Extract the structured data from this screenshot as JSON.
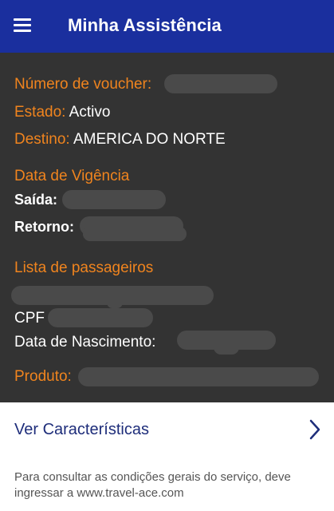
{
  "appbar": {
    "title": "Minha Assistência",
    "menu_icon": "hamburger-menu-icon"
  },
  "voucher": {
    "number_label": "Número de voucher:",
    "status_label": "Estado:",
    "status_value": "Activo",
    "destination_label": "Destino:",
    "destination_value": "AMERICA DO NORTE"
  },
  "validity": {
    "heading": "Data de Vigência",
    "departure_label": "Saída:",
    "return_label": "Retorno:"
  },
  "passengers": {
    "heading": "Lista de passageiros",
    "cpf_label": "CPF",
    "birth_label": "Data de Nascimento:"
  },
  "product": {
    "label": "Produto:"
  },
  "features": {
    "link_label": "Ver Características",
    "chevron_icon": "chevron-right-icon"
  },
  "footer": {
    "note": "Para consultar as condições gerais do serviço, deve ingressar a www.travel-ace.com"
  },
  "colors": {
    "appbar_bg": "#1a2f9e",
    "panel_bg": "#333333",
    "accent_orange": "#f0841e",
    "link_blue": "#1e2d7a"
  }
}
